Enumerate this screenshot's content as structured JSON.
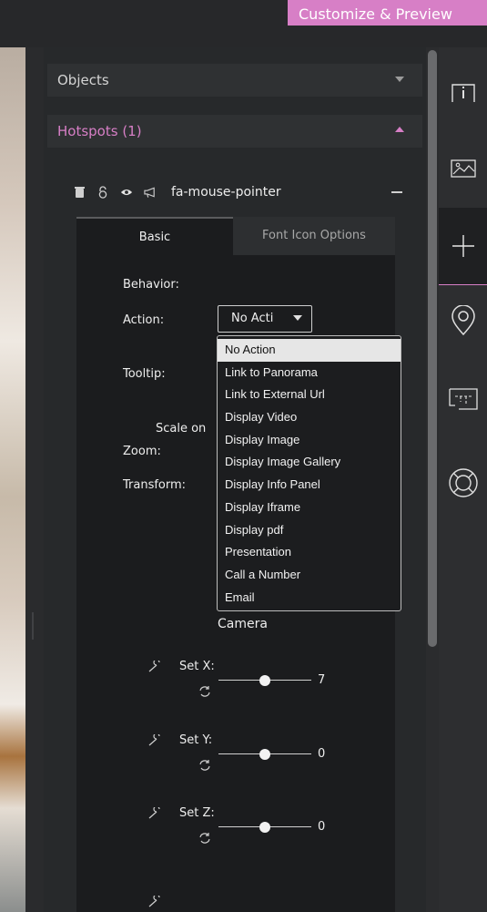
{
  "header": {
    "customize_label": "Customize & Preview"
  },
  "sections": {
    "objects_label": "Objects",
    "hotspots_label": "Hotspots (1)"
  },
  "hotspot": {
    "name": "fa-mouse-pointer",
    "icons": [
      "trash-icon",
      "lock-icon",
      "eye-icon",
      "megaphone-icon"
    ]
  },
  "tabs": {
    "basic": "Basic",
    "font_icon_options": "Font Icon Options"
  },
  "form": {
    "behavior_label": "Behavior:",
    "action_label": "Action:",
    "action_value": "No Acti",
    "tooltip_label": "Tooltip:",
    "scale_on_label": "Scale on",
    "zoom_label": "Zoom:",
    "transform_label": "Transform:",
    "camera_label": "Camera"
  },
  "action_options": [
    "No Action",
    "Link to Panorama",
    "Link to External Url",
    "Display Video",
    "Display Image",
    "Display Image Gallery",
    "Display Info Panel",
    "Display Iframe",
    "Display pdf",
    "Presentation",
    "Call a Number",
    "Email"
  ],
  "selected_action_index": 0,
  "camera": {
    "set_x": {
      "label": "Set X:",
      "value": "7",
      "level": 0.5
    },
    "set_y": {
      "label": "Set Y:",
      "value": "0",
      "level": 0.5
    },
    "set_z": {
      "label": "Set Z:",
      "value": "0",
      "level": 0.5
    }
  },
  "toolbar_icons": [
    "info-box-icon",
    "image-icon",
    "plus-icon",
    "location-pin-icon",
    "floorplan-icon",
    "lifebuoy-icon"
  ],
  "colors": {
    "accent": "#d77fc6",
    "panel": "#27292b",
    "background": "#1e1f21"
  }
}
